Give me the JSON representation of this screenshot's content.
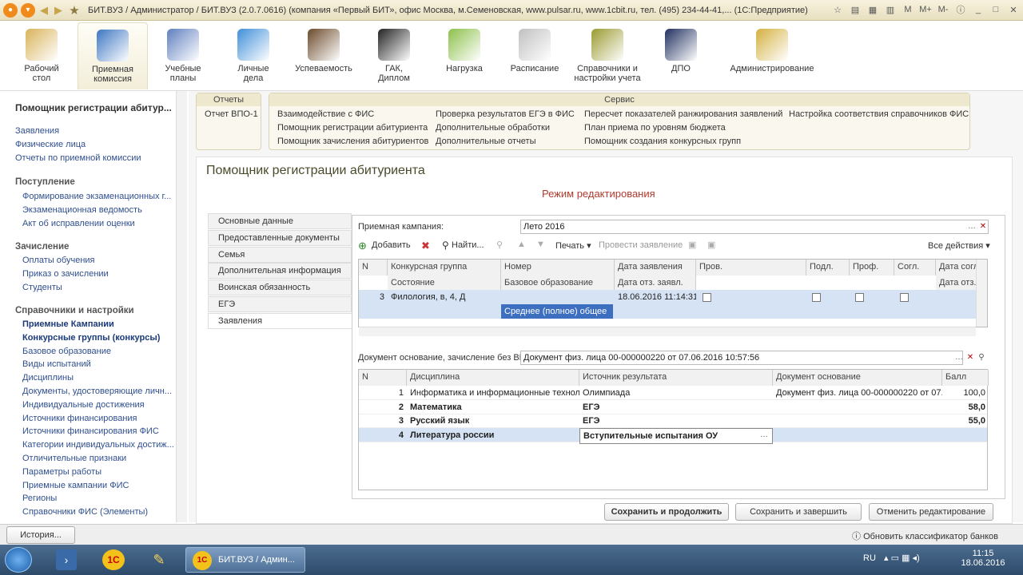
{
  "window": {
    "title": "БИТ.ВУЗ / Администратор / БИТ.ВУЗ (2.0.7.0616) (компания «Первый БИТ», офис Москва, м.Семеновская, www.pulsar.ru, www.1cbit.ru, тел. (495) 234-44-41,... (1С:Предприятие)",
    "m": "M",
    "mplus": "M+",
    "mminus": "M-"
  },
  "sections": [
    {
      "l1": "Рабочий",
      "l2": "стол",
      "icon": "desk-icon",
      "color": "#d9b35a"
    },
    {
      "l1": "Приемная",
      "l2": "комиссия",
      "icon": "building-icon",
      "color": "#3d77c2"
    },
    {
      "l1": "Учебные",
      "l2": "планы",
      "icon": "notebook-icon",
      "color": "#5f7fbf"
    },
    {
      "l1": "Личные",
      "l2": "дела",
      "icon": "folder-icon",
      "color": "#3f8fd8"
    },
    {
      "l1": "Успеваемость",
      "l2": "",
      "icon": "student-icon",
      "color": "#6b4a2a"
    },
    {
      "l1": "ГАК,",
      "l2": "Диплом",
      "icon": "graduation-cap-icon",
      "color": "#222222"
    },
    {
      "l1": "Нагрузка",
      "l2": "",
      "icon": "pie-chart-icon",
      "color": "#8cc04a"
    },
    {
      "l1": "Расписание",
      "l2": "",
      "icon": "clock-icon",
      "color": "#c0c0c0"
    },
    {
      "l1": "Справочники и",
      "l2": "настройки учета",
      "icon": "books-icon",
      "color": "#9a9a30"
    },
    {
      "l1": "ДПО",
      "l2": "",
      "icon": "teacher-icon",
      "color": "#1f2f5f"
    },
    {
      "l1": "Администрирование",
      "l2": "",
      "icon": "database-icon",
      "color": "#d4b040"
    }
  ],
  "left": {
    "header": "Помощник регистрации абитур...",
    "items1": [
      "Заявления",
      "Физические лица",
      "Отчеты по приемной комиссии"
    ],
    "g1": "Поступление",
    "items2": [
      "Формирование экзаменационных г...",
      "Экзаменационная ведомость",
      "Акт об исправлении оценки"
    ],
    "g2": "Зачисление",
    "items3": [
      "Оплаты обучения",
      "Приказ о зачислении",
      "Студенты"
    ],
    "g3": "Справочники и настройки",
    "items4": [
      "Приемные Кампании",
      "Конкурсные группы (конкурсы)",
      "Базовое образование",
      "Виды испытаний",
      "Дисциплины",
      "Документы, удостоверяющие личн...",
      "Индивидуальные достижения",
      "Источники финансирования",
      "Источники финансирования ФИС",
      "Категории индивидуальных достиж...",
      "Отличительные признаки",
      "Параметры работы",
      "Приемные кампании ФИС",
      "Регионы",
      "Справочники ФИС (Элементы)"
    ]
  },
  "commands": {
    "reports_hdr": "Отчеты",
    "report1": "Отчет ВПО-1",
    "service_hdr": "Сервис",
    "c1": "Взаимодействие  с ФИС",
    "c2": "Помощник регистрации абитуриента",
    "c3": "Помощник зачисления абитуриентов",
    "c4": "Проверка результатов ЕГЭ в ФИС",
    "c5": "Дополнительные обработки",
    "c6": "Дополнительные отчеты",
    "c7": "Пересчет показателей ранжирования заявлений",
    "c8": "План приема по уровням бюджета",
    "c9": "Помощник создания конкурсных групп",
    "c10": "Настройка соответствия справочников ФИС"
  },
  "form": {
    "title": "Помощник регистрации абитуриента",
    "mode": "Режим редактирования",
    "tabs": [
      "Основные данные",
      "Предоставленные документы",
      "Семья",
      "Дополнительная информация",
      "Воинская обязанность",
      "ЕГЭ",
      "Заявления"
    ],
    "campaign_label": "Приемная кампания:",
    "campaign_value": "Лето 2016",
    "tb_add": "Добавить",
    "tb_find": "Найти...",
    "tb_print": "Печать",
    "tb_submit": "Провести заявление",
    "tb_all": "Все действия",
    "g1_headers": [
      "N",
      "Конкурсная группа",
      "Номер",
      "Дата заявления",
      "Пров.",
      "Подл.",
      "Проф.",
      "Согл.",
      "Дата согл"
    ],
    "g1_headers2": [
      "Состояние",
      "Базовое образование",
      "Дата отз. заявл.",
      "Дата отз."
    ],
    "g1_row": {
      "n": "3",
      "group": "Филология, в, 4, Д",
      "base": "Среднее (полное) общее",
      "date": "18.06.2016 11:14:31"
    },
    "doc_label": "Документ основание, зачисление без ВИ:",
    "doc_value": "Документ физ. лица 00-000000220 от 07.06.2016 10:57:56",
    "g2_headers": [
      "N",
      "Дисциплина",
      "Источник результата",
      "Документ основание",
      "Балл"
    ],
    "g2_rows": [
      {
        "n": "1",
        "disc": "Информатика и информационные технол...",
        "src": "Олимпиада",
        "doc": "Документ физ. лица 00-000000220 от 07....",
        "score": "100,0"
      },
      {
        "n": "2",
        "disc": "Математика",
        "src": "ЕГЭ",
        "doc": "",
        "score": "58,0"
      },
      {
        "n": "3",
        "disc": "Русский язык",
        "src": "ЕГЭ",
        "doc": "",
        "score": "55,0"
      },
      {
        "n": "4",
        "disc": "Литература россии",
        "src": "Вступительные испытания ОУ",
        "doc": "",
        "score": ""
      }
    ],
    "btn_save_cont": "Сохранить и продолжить",
    "btn_save_close": "Сохранить и завершить",
    "btn_cancel": "Отменить редактирование"
  },
  "status": {
    "history": "История...",
    "update": "Обновить классификатор банков"
  },
  "taskbar": {
    "app": "БИТ.ВУЗ / Админ...",
    "lang": "RU",
    "time": "11:15",
    "date": "18.06.2016"
  }
}
